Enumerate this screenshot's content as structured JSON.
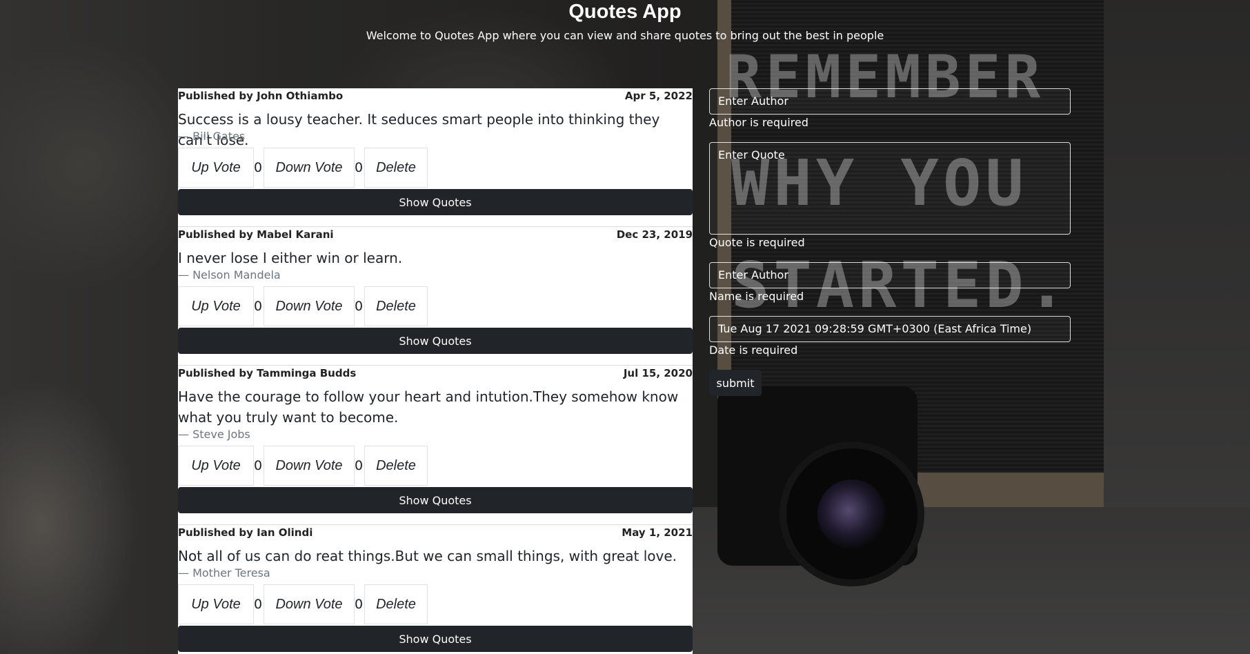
{
  "app": {
    "title": "Quotes App",
    "subtitle": "Welcome to Quotes App where you can view and share quotes to bring out the best in people"
  },
  "quotes": [
    {
      "published": "Published by John Othiambo",
      "date": "Apr 5, 2022",
      "text": "Success is a lousy teacher. It seduces smart people into thinking they can't lose.",
      "author": "— Bill Gates",
      "upvote_label": "Up Vote",
      "upvotes": "0",
      "downvote_label": "Down Vote",
      "downvotes": "0",
      "delete_label": "Delete",
      "show_label": "Show Quotes"
    },
    {
      "published": "Published by Mabel Karani",
      "date": "Dec 23, 2019",
      "text": "I never lose I either win or learn.",
      "author": "— Nelson Mandela",
      "upvote_label": "Up Vote",
      "upvotes": "0",
      "downvote_label": "Down Vote",
      "downvotes": "0",
      "delete_label": "Delete",
      "show_label": "Show Quotes"
    },
    {
      "published": "Published by Tamminga Budds",
      "date": "Jul 15, 2020",
      "text": "Have the courage to follow your heart and intution.They somehow know what you truly want to become.",
      "author": "— Steve Jobs",
      "upvote_label": "Up Vote",
      "upvotes": "0",
      "downvote_label": "Down Vote",
      "downvotes": "0",
      "delete_label": "Delete",
      "show_label": "Show Quotes"
    },
    {
      "published": "Published by Ian Olindi",
      "date": "May 1, 2021",
      "text": "Not all of us can do reat things.But we can small things, with great love.",
      "author": "— Mother Teresa",
      "upvote_label": "Up Vote",
      "upvotes": "0",
      "downvote_label": "Down Vote",
      "downvotes": "0",
      "delete_label": "Delete",
      "show_label": "Show Quotes"
    }
  ],
  "form": {
    "author_placeholder": "Enter Author",
    "author_error": "Author is required",
    "quote_placeholder": "Enter Quote",
    "quote_error": "Quote is required",
    "name_placeholder": "Enter Author",
    "name_error": "Name is required",
    "date_value": "Tue Aug 17 2021 09:28:59 GMT+0300 (East Africa Time)",
    "date_error": "Date is required",
    "submit_label": "submit"
  },
  "background": {
    "board_line1": "REMEMBER",
    "board_line2": "WHY YOU",
    "board_line3": "STARTED."
  },
  "colors": {
    "dark_button": "#212529",
    "card_background": "#ffffff",
    "author_gray": "#6c757d"
  }
}
